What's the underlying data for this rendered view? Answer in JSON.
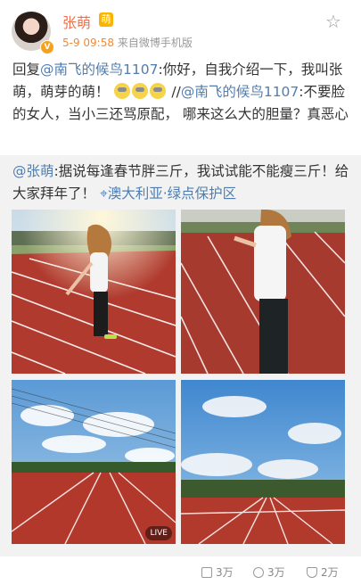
{
  "post": {
    "username": "张萌",
    "vip_badge": "V",
    "crown_icon": "萌",
    "timestamp": "5-9 09:58",
    "source": "来自微博手机版",
    "text_parts": {
      "reply": "回复",
      "mention1": "@南飞的候鸟1107",
      "text1": ":你好，自我介绍一下，我叫张萌，萌芽的萌！",
      "sep": " //",
      "mention2": "@南飞的候鸟1107",
      "text2": ":不要脸的女人，当小三还骂原配， 哪来这么大的胆量？真恶心"
    }
  },
  "original": {
    "mention": "@张萌",
    "text": ":据说每逢春节胖三斤，我试试能不能瘦三斤！给大家拜年了！",
    "location": "澳大利亚·绿点保护区",
    "live_badge": "LIVE"
  },
  "actions": {
    "repost": "3万",
    "comment": "3万",
    "like": "2万"
  },
  "colors": {
    "username": "#eb7350",
    "link": "#507daf",
    "repost_bg": "#f2f2f2",
    "track": "#b5392e"
  }
}
